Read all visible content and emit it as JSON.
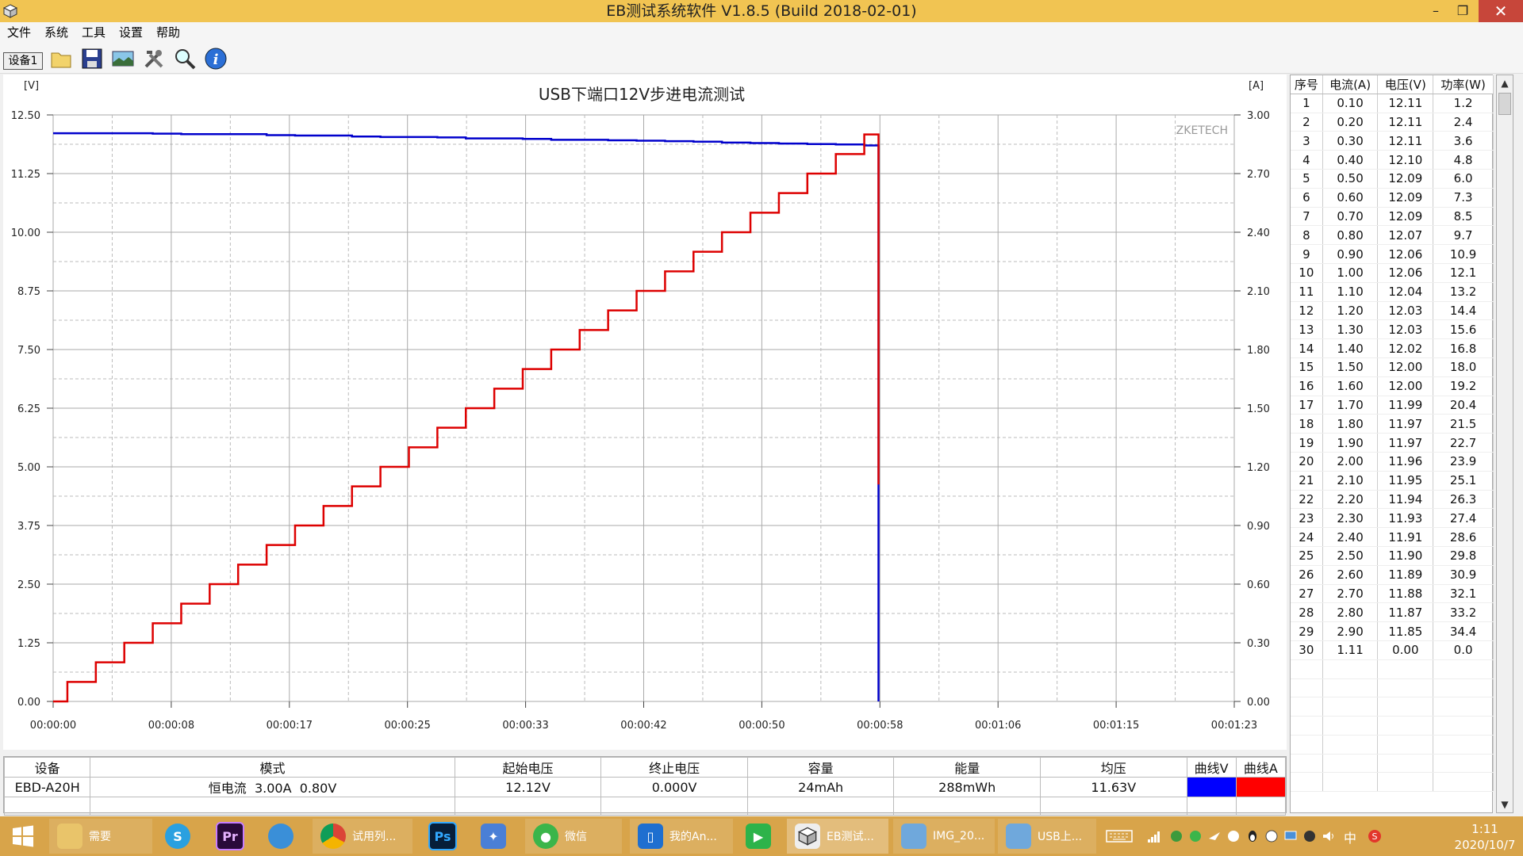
{
  "window": {
    "title": "EB测试系统软件 V1.8.5 (Build 2018-02-01)",
    "minimize": "–",
    "maximize": "❐",
    "close": "✕"
  },
  "menu": [
    "文件",
    "系统",
    "工具",
    "设置",
    "帮助"
  ],
  "toolbar": {
    "device_label": "设备1"
  },
  "chart_data": {
    "type": "line",
    "title": "USB下端口12V步进电流测试",
    "watermark": "ZKETECH",
    "y_left_unit": "[V]",
    "y_right_unit": "[A]",
    "y_left_range": [
      0,
      12.5
    ],
    "y_right_range": [
      0,
      3.0
    ],
    "y_left_ticks": [
      "0.00",
      "1.25",
      "2.50",
      "3.75",
      "5.00",
      "6.25",
      "7.50",
      "8.75",
      "10.00",
      "11.25",
      "12.50"
    ],
    "y_right_ticks": [
      "0.00",
      "0.30",
      "0.60",
      "0.90",
      "1.20",
      "1.50",
      "1.80",
      "2.10",
      "2.40",
      "2.70",
      "3.00"
    ],
    "x_range_s": [
      0,
      83
    ],
    "x_ticks": [
      "00:00:00",
      "00:00:08",
      "00:00:17",
      "00:00:25",
      "00:00:33",
      "00:00:42",
      "00:00:50",
      "00:00:58",
      "00:01:06",
      "00:01:15",
      "00:01:23"
    ],
    "series": [
      {
        "name": "曲线V",
        "axis": "left",
        "color": "#0000cc",
        "x": [
          0,
          5,
          7,
          9,
          11,
          13,
          15,
          17,
          19,
          21,
          23,
          25,
          27,
          29,
          31,
          33,
          35,
          37,
          39,
          41,
          43,
          45,
          47,
          49,
          51,
          53,
          55,
          57,
          58,
          58
        ],
        "y": [
          12.11,
          12.11,
          12.1,
          12.09,
          12.09,
          12.09,
          12.07,
          12.06,
          12.06,
          12.04,
          12.03,
          12.03,
          12.02,
          12.0,
          12.0,
          11.99,
          11.97,
          11.97,
          11.96,
          11.95,
          11.94,
          11.93,
          11.91,
          11.9,
          11.89,
          11.88,
          11.87,
          11.85,
          11.85,
          0
        ]
      },
      {
        "name": "曲线A",
        "axis": "right",
        "color": "#dd0000",
        "x": [
          0,
          1,
          3,
          5,
          7,
          9,
          11,
          13,
          15,
          17,
          19,
          21,
          23,
          25,
          27,
          29,
          31,
          33,
          35,
          37,
          39,
          41,
          43,
          45,
          47,
          49,
          51,
          53,
          55,
          57,
          58,
          58
        ],
        "y": [
          0,
          0.1,
          0.2,
          0.3,
          0.4,
          0.5,
          0.6,
          0.7,
          0.8,
          0.9,
          1.0,
          1.1,
          1.2,
          1.3,
          1.4,
          1.5,
          1.6,
          1.7,
          1.8,
          1.9,
          2.0,
          2.1,
          2.2,
          2.3,
          2.4,
          2.5,
          2.6,
          2.7,
          2.8,
          2.9,
          2.9,
          1.11
        ]
      }
    ]
  },
  "readings": {
    "headers": [
      "序号",
      "电流(A)",
      "电压(V)",
      "功率(W)"
    ],
    "rows": [
      [
        "1",
        "0.10",
        "12.11",
        "1.2"
      ],
      [
        "2",
        "0.20",
        "12.11",
        "2.4"
      ],
      [
        "3",
        "0.30",
        "12.11",
        "3.6"
      ],
      [
        "4",
        "0.40",
        "12.10",
        "4.8"
      ],
      [
        "5",
        "0.50",
        "12.09",
        "6.0"
      ],
      [
        "6",
        "0.60",
        "12.09",
        "7.3"
      ],
      [
        "7",
        "0.70",
        "12.09",
        "8.5"
      ],
      [
        "8",
        "0.80",
        "12.07",
        "9.7"
      ],
      [
        "9",
        "0.90",
        "12.06",
        "10.9"
      ],
      [
        "10",
        "1.00",
        "12.06",
        "12.1"
      ],
      [
        "11",
        "1.10",
        "12.04",
        "13.2"
      ],
      [
        "12",
        "1.20",
        "12.03",
        "14.4"
      ],
      [
        "13",
        "1.30",
        "12.03",
        "15.6"
      ],
      [
        "14",
        "1.40",
        "12.02",
        "16.8"
      ],
      [
        "15",
        "1.50",
        "12.00",
        "18.0"
      ],
      [
        "16",
        "1.60",
        "12.00",
        "19.2"
      ],
      [
        "17",
        "1.70",
        "11.99",
        "20.4"
      ],
      [
        "18",
        "1.80",
        "11.97",
        "21.5"
      ],
      [
        "19",
        "1.90",
        "11.97",
        "22.7"
      ],
      [
        "20",
        "2.00",
        "11.96",
        "23.9"
      ],
      [
        "21",
        "2.10",
        "11.95",
        "25.1"
      ],
      [
        "22",
        "2.20",
        "11.94",
        "26.3"
      ],
      [
        "23",
        "2.30",
        "11.93",
        "27.4"
      ],
      [
        "24",
        "2.40",
        "11.91",
        "28.6"
      ],
      [
        "25",
        "2.50",
        "11.90",
        "29.8"
      ],
      [
        "26",
        "2.60",
        "11.89",
        "30.9"
      ],
      [
        "27",
        "2.70",
        "11.88",
        "32.1"
      ],
      [
        "28",
        "2.80",
        "11.87",
        "33.2"
      ],
      [
        "29",
        "2.90",
        "11.85",
        "34.4"
      ],
      [
        "30",
        "1.11",
        "0.00",
        "0.0"
      ]
    ]
  },
  "info": {
    "headers": [
      "设备",
      "模式",
      "起始电压",
      "终止电压",
      "容量",
      "能量",
      "均压",
      "曲线V",
      "曲线A"
    ],
    "device": "EBD-A20H",
    "mode": "恒电流  3.00A  0.80V",
    "start_voltage": "12.12V",
    "end_voltage": "0.000V",
    "capacity": "24mAh",
    "energy": "288mWh",
    "avg_voltage": "11.63V",
    "curve_v_color": "#0000ff",
    "curve_a_color": "#ff0000"
  },
  "taskbar": {
    "items": [
      {
        "label": "",
        "icon": "windows-start-icon"
      },
      {
        "label": "需要",
        "icon": "folder-icon"
      },
      {
        "label": "",
        "icon": "skype-icon"
      },
      {
        "label": "Pr",
        "icon": "premiere-icon"
      },
      {
        "label": "",
        "icon": "browser-icon"
      },
      {
        "label": "试用列...",
        "icon": "chrome-icon"
      },
      {
        "label": "Ps",
        "icon": "photoshop-icon"
      },
      {
        "label": "",
        "icon": "bird-app-icon"
      },
      {
        "label": "微信",
        "icon": "wechat-icon"
      },
      {
        "label": "我的An...",
        "icon": "phone-icon"
      },
      {
        "label": "",
        "icon": "play-icon"
      },
      {
        "label": "EB测试...",
        "icon": "eb-app-icon"
      },
      {
        "label": "IMG_20...",
        "icon": "image-icon"
      },
      {
        "label": "USB上...",
        "icon": "image-icon"
      }
    ],
    "clock_time": "1:11",
    "clock_date": "2020/10/7",
    "ime": "中"
  }
}
